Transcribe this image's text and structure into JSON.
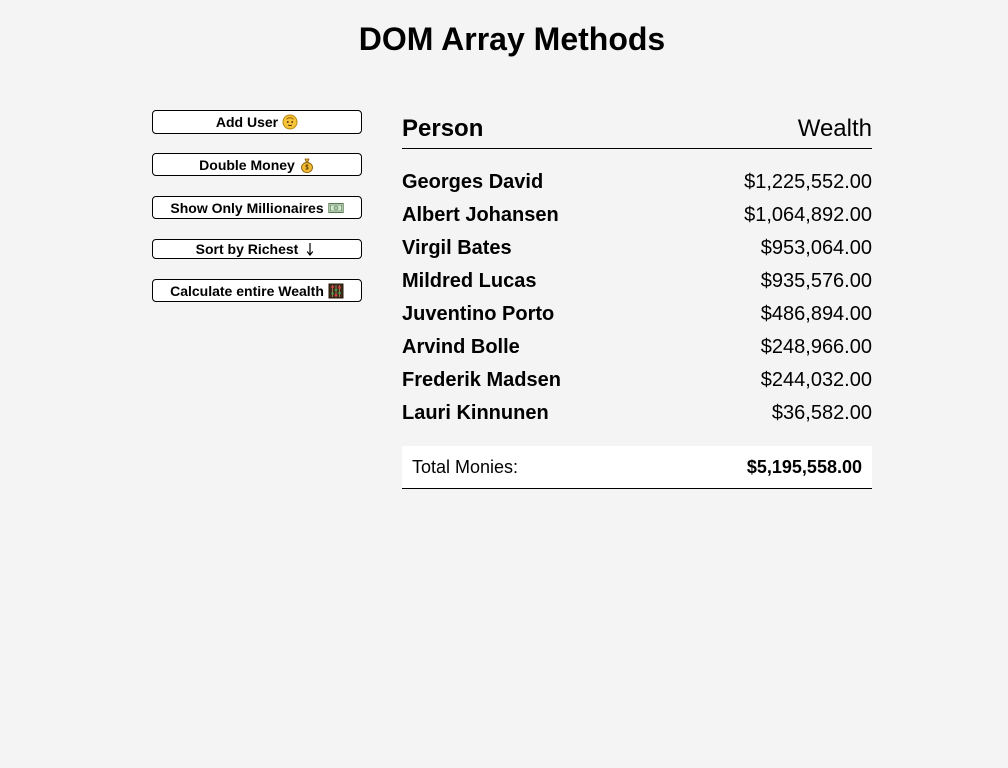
{
  "page": {
    "title": "DOM Array Methods"
  },
  "actions": {
    "add_user": {
      "label": "Add User",
      "icon": "baby-face-icon"
    },
    "double_money": {
      "label": "Double Money",
      "icon": "money-bag-icon"
    },
    "show_millionaires": {
      "label": "Show Only Millionaires",
      "icon": "dollar-banknote-icon"
    },
    "sort_richest": {
      "label": "Sort by Richest",
      "icon": "down-arrow-icon"
    },
    "calculate_wealth": {
      "label": "Calculate entire Wealth",
      "icon": "abacus-icon"
    }
  },
  "table": {
    "headers": {
      "person": "Person",
      "wealth": "Wealth"
    },
    "rows": [
      {
        "name": "Georges David",
        "wealth": "$1,225,552.00"
      },
      {
        "name": "Albert Johansen",
        "wealth": "$1,064,892.00"
      },
      {
        "name": "Virgil Bates",
        "wealth": "$953,064.00"
      },
      {
        "name": "Mildred Lucas",
        "wealth": "$935,576.00"
      },
      {
        "name": "Juventino Porto",
        "wealth": "$486,894.00"
      },
      {
        "name": "Arvind Bolle",
        "wealth": "$248,966.00"
      },
      {
        "name": "Frederik Madsen",
        "wealth": "$244,032.00"
      },
      {
        "name": "Lauri Kinnunen",
        "wealth": "$36,582.00"
      }
    ],
    "total": {
      "label": "Total Monies:",
      "value": "$5,195,558.00"
    }
  },
  "colors": {
    "background": "#f4f4f4",
    "button_background": "#ffffff",
    "border": "#000000",
    "text": "#000000"
  }
}
